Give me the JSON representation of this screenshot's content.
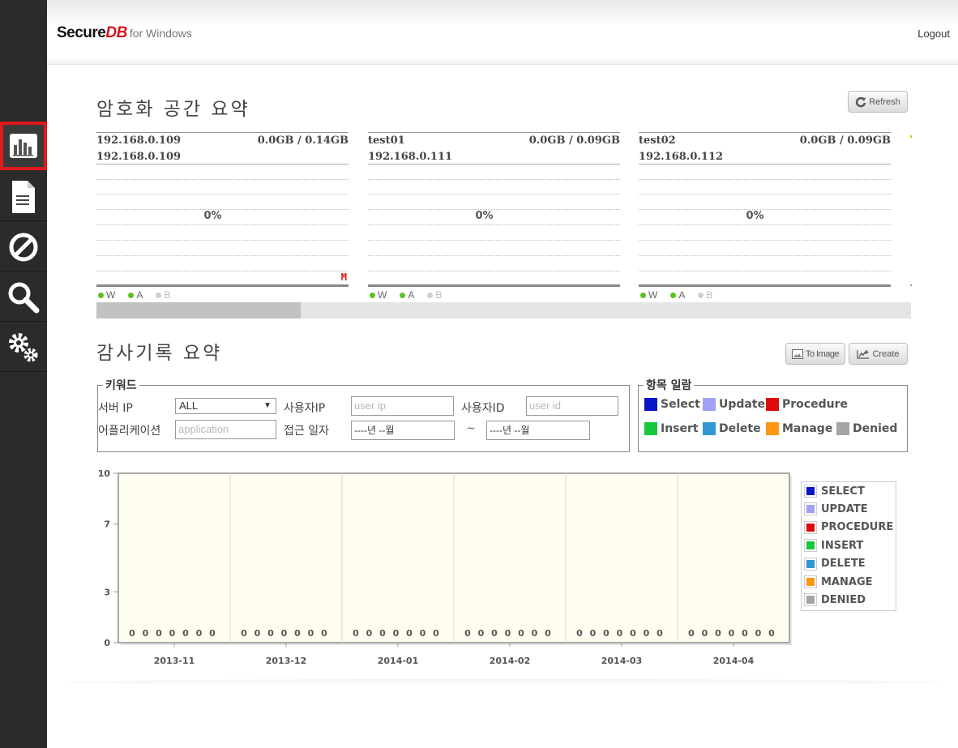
{
  "app": {
    "brand_prefix": "Secure",
    "brand_dd": "DB",
    "brand_suffix": "for Windows",
    "logout": "Logout"
  },
  "sidebar": {
    "items": [
      {
        "icon": "bar-chart-icon",
        "active": true
      },
      {
        "icon": "document-icon",
        "active": false
      },
      {
        "icon": "block-icon",
        "active": false
      },
      {
        "icon": "search-icon",
        "active": false
      },
      {
        "icon": "gears-icon",
        "active": false
      }
    ]
  },
  "encryption_summary": {
    "title": "암호화 공간 요약",
    "refresh_label": "Refresh",
    "servers": [
      {
        "name": "192.168.0.109",
        "usage": "0.0GB / 0.14GB",
        "ip": "192.168.0.109",
        "percent": "0%",
        "marker": "M",
        "legend": [
          "W",
          "A",
          "B"
        ]
      },
      {
        "name": "test01",
        "usage": "0.0GB / 0.09GB",
        "ip": "192.168.0.111",
        "percent": "0%",
        "marker": "",
        "legend": [
          "W",
          "A",
          "B"
        ]
      },
      {
        "name": "test02",
        "usage": "0.0GB / 0.09GB",
        "ip": "192.168.0.112",
        "percent": "0%",
        "marker": "",
        "legend": [
          "W",
          "A",
          "B"
        ]
      }
    ],
    "legend_colors": {
      "W": "#5bc21e",
      "A": "#5bc21e",
      "B": "#cfcfcf"
    }
  },
  "audit_summary": {
    "title": "감사기록 요약",
    "to_image_label": "To Image",
    "create_label": "Create",
    "keyword": {
      "legend": "키워드",
      "server_ip_label": "서버 IP",
      "server_ip_value": "ALL",
      "user_ip_label": "사용자IP",
      "user_ip_placeholder": "user ip",
      "user_id_label": "사용자ID",
      "user_id_placeholder": "user id",
      "application_label": "어플리케이션",
      "application_placeholder": "application",
      "access_date_label": "접근 일자",
      "date_from": "----년 --월",
      "date_sep": "~",
      "date_to": "----년 --월"
    },
    "categories": {
      "legend": "항목 일람",
      "items": [
        {
          "label": "Select",
          "color": "#0a14c8"
        },
        {
          "label": "Update",
          "color": "#a0a0f5"
        },
        {
          "label": "Procedure",
          "color": "#dc0a0a"
        },
        {
          "label": "Insert",
          "color": "#15c83c"
        },
        {
          "label": "Delete",
          "color": "#3296d2"
        },
        {
          "label": "Manage",
          "color": "#ff9614"
        },
        {
          "label": "Denied",
          "color": "#a5a5a5"
        }
      ]
    }
  },
  "chart_data": {
    "type": "bar",
    "categories": [
      "2013-11",
      "2013-12",
      "2014-01",
      "2014-02",
      "2014-03",
      "2014-04"
    ],
    "yticks": [
      0,
      3,
      7,
      10
    ],
    "ylim": [
      0,
      10
    ],
    "series": [
      {
        "name": "SELECT",
        "color": "#0a14c8",
        "values": [
          0,
          0,
          0,
          0,
          0,
          0
        ]
      },
      {
        "name": "UPDATE",
        "color": "#a0a0f5",
        "values": [
          0,
          0,
          0,
          0,
          0,
          0
        ]
      },
      {
        "name": "PROCEDURE",
        "color": "#dc0a0a",
        "values": [
          0,
          0,
          0,
          0,
          0,
          0
        ]
      },
      {
        "name": "INSERT",
        "color": "#15c83c",
        "values": [
          0,
          0,
          0,
          0,
          0,
          0
        ]
      },
      {
        "name": "DELETE",
        "color": "#3296d2",
        "values": [
          0,
          0,
          0,
          0,
          0,
          0
        ]
      },
      {
        "name": "MANAGE",
        "color": "#ff9614",
        "values": [
          0,
          0,
          0,
          0,
          0,
          0
        ]
      },
      {
        "name": "DENIED",
        "color": "#a5a5a5",
        "values": [
          0,
          0,
          0,
          0,
          0,
          0
        ]
      }
    ],
    "grid": true,
    "legend": "right"
  }
}
